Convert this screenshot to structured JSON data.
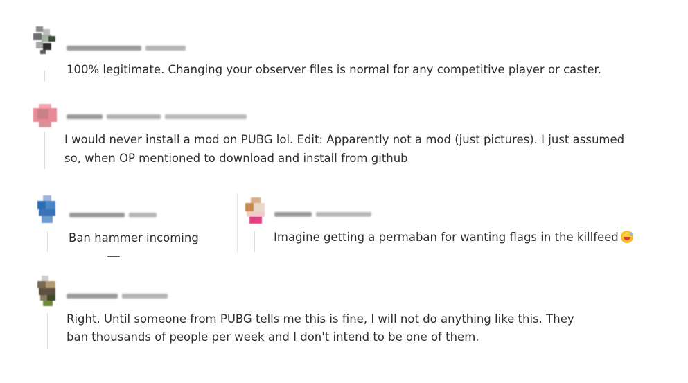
{
  "comments": [
    {
      "text": "100% legitimate. Changing your observer files is normal for any competitive player or caster."
    },
    {
      "text_line1": "I would never install a mod on PUBG lol. Edit: Apparently not a mod (just pictures). I just assumed",
      "text_line2": "so, when OP mentioned to download and install from github"
    },
    {
      "text": "Ban hammer incoming"
    },
    {
      "text": "Imagine getting a permaban for wanting flags in the killfeed",
      "emoji": "smiling-face-with-sweat-icon"
    },
    {
      "text_line1": "Right. Until someone from PUBG tells me this is fine, I will not do anything like this. They",
      "text_line2": "ban thousands of people per week and I don't intend to be one of them."
    }
  ]
}
